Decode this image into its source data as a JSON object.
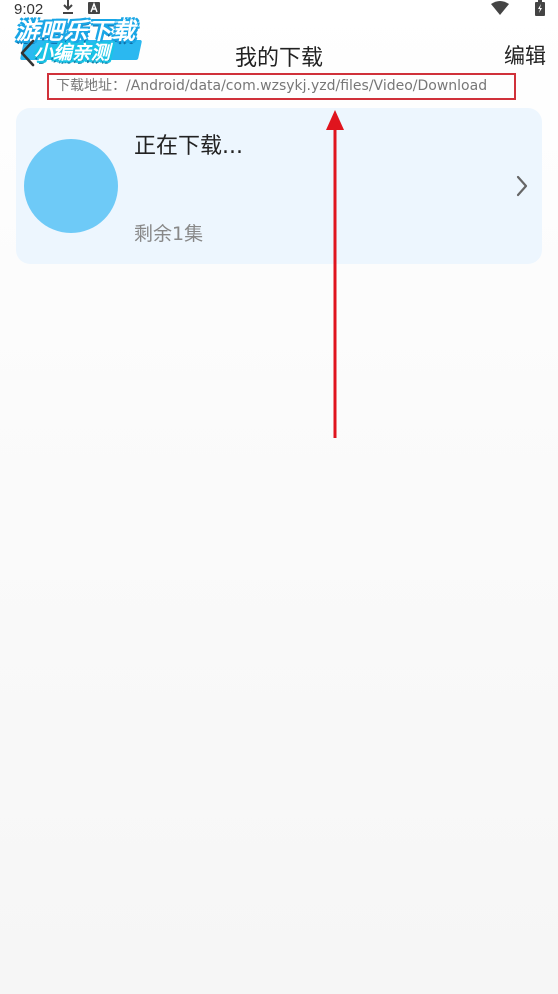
{
  "status_bar": {
    "time": "9:02",
    "icons": [
      "download-icon",
      "a-letter-icon",
      "wifi-icon",
      "battery-icon"
    ]
  },
  "watermark": {
    "line1": "游吧乐下载",
    "line2": "小编亲测",
    "color": "#19a6e6"
  },
  "header": {
    "back_icon": "chevron-left-icon",
    "title": "我的下载",
    "edit_label": "编辑"
  },
  "path": {
    "label": "下载地址：",
    "value": "/Android/data/com.wzsykj.yzd/files/Video/Download",
    "highlight_color": "#d0313a"
  },
  "download_item": {
    "status": "正在下载...",
    "remaining": "剩余1集",
    "cover_color": "#6ecaf7",
    "card_color": "#edf6fe",
    "chevron_icon": "chevron-right-icon"
  },
  "annotation": {
    "icon": "arrow-up-icon",
    "color": "#e0141e"
  }
}
